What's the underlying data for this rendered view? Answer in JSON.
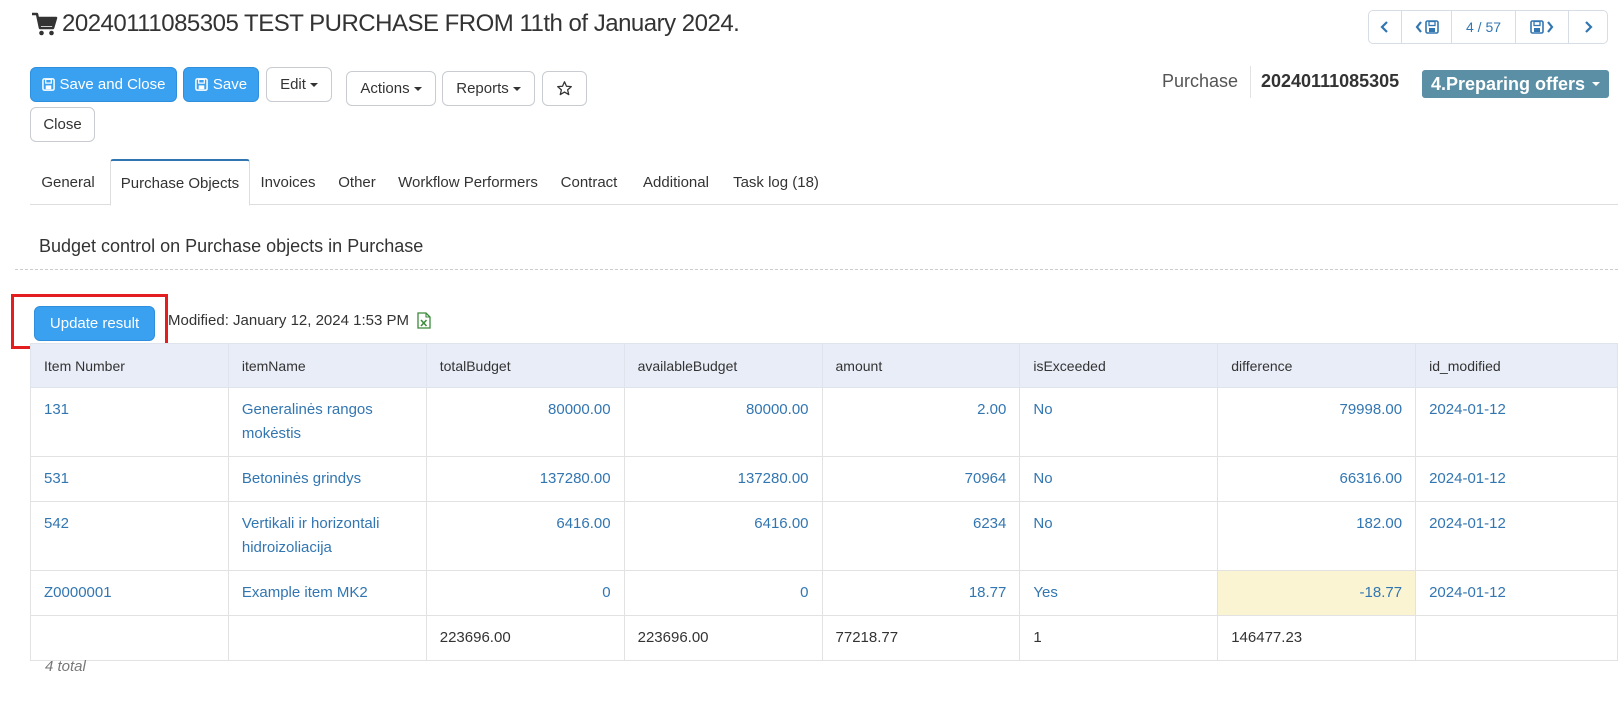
{
  "header": {
    "title": "20240111085305 TEST PURCHASE FROM 11th of January 2024.",
    "pager": "4 / 57"
  },
  "toolbar": {
    "save_close": "Save and Close",
    "save": "Save",
    "edit": "Edit",
    "actions": "Actions",
    "reports": "Reports",
    "close": "Close"
  },
  "record": {
    "type_label": "Purchase",
    "number": "20240111085305",
    "status": "4.Preparing offers"
  },
  "tabs": [
    "General",
    "Purchase Objects",
    "Invoices",
    "Other",
    "Workflow Performers",
    "Contract",
    "Additional",
    "Task log (18)"
  ],
  "section": {
    "title": "Budget control on Purchase objects in Purchase",
    "update_button": "Update result",
    "modified": "Modified: January 12, 2024 1:53 PM"
  },
  "table": {
    "columns": [
      "Item Number",
      "itemName",
      "totalBudget",
      "availableBudget",
      "amount",
      "isExceeded",
      "difference",
      "id_modified"
    ],
    "rows": [
      [
        "131",
        "Generalinės rangos mokėstis",
        "80000.00",
        "80000.00",
        "2.00",
        "No",
        "79998.00",
        "2024-01-12"
      ],
      [
        "531",
        "Betoninės grindys",
        "137280.00",
        "137280.00",
        "70964",
        "No",
        "66316.00",
        "2024-01-12"
      ],
      [
        "542",
        "Vertikali ir horizontali hidroizoliacija",
        "6416.00",
        "6416.00",
        "6234",
        "No",
        "182.00",
        "2024-01-12"
      ],
      [
        "Z0000001",
        "Example item MK2",
        "0",
        "0",
        "18.77",
        "Yes",
        "-18.77",
        "2024-01-12"
      ]
    ],
    "totals": [
      "",
      "",
      "223696.00",
      "223696.00",
      "77218.77",
      "1",
      "146477.23",
      ""
    ]
  },
  "footer": {
    "count": "4 total"
  },
  "colors": {
    "primary": "#3aa0f0",
    "link": "#3276b1",
    "status_badge": "#5a8fa6",
    "warning_cell": "#fbf4d3",
    "highlight_border": "#e41e1e"
  }
}
